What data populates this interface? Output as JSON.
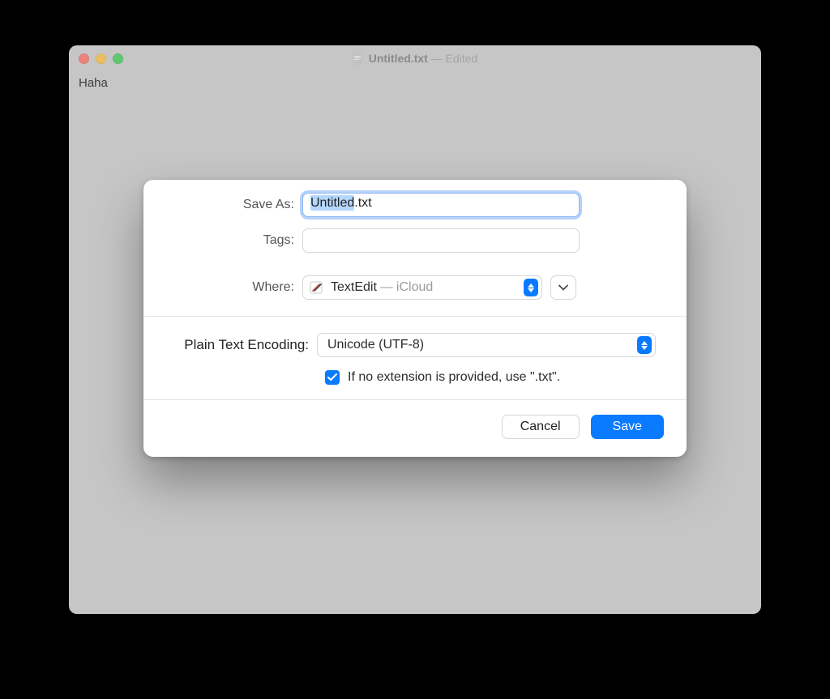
{
  "window": {
    "title": "Untitled.txt",
    "status_suffix": "Edited",
    "content_text": "Haha"
  },
  "sheet": {
    "save_as": {
      "label": "Save As:",
      "value_selected": "Untitled",
      "value_rest": ".txt"
    },
    "tags": {
      "label": "Tags:",
      "value": ""
    },
    "where": {
      "label": "Where:",
      "folder": "TextEdit",
      "location": "iCloud"
    },
    "encoding": {
      "label": "Plain Text Encoding:",
      "value": "Unicode (UTF-8)"
    },
    "extension_checkbox": {
      "checked": true,
      "label": "If no extension is provided, use \".txt\"."
    },
    "buttons": {
      "cancel": "Cancel",
      "save": "Save"
    }
  }
}
